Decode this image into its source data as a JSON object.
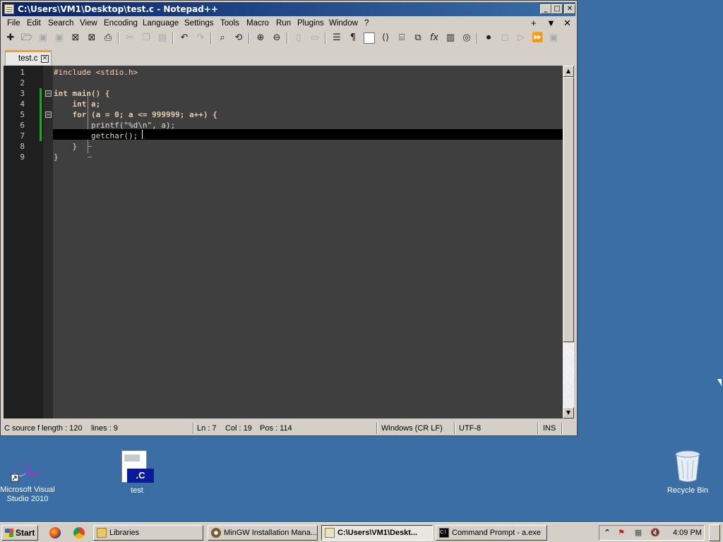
{
  "window": {
    "title": "C:\\Users\\VM1\\Desktop\\test.c - Notepad++",
    "minimize": "_",
    "maximize": "□",
    "close": "✕",
    "tab_close": "✕"
  },
  "menu": {
    "items": [
      "File",
      "Edit",
      "Search",
      "View",
      "Encoding",
      "Language",
      "Settings",
      "Tools",
      "Macro",
      "Run",
      "Plugins",
      "Window",
      "?"
    ],
    "add": "+",
    "dropdown": "▼",
    "close": "✕"
  },
  "tabs": [
    {
      "label": "test.c",
      "close": "✕"
    }
  ],
  "editor": {
    "line_numbers": [
      "1",
      "2",
      "3",
      "4",
      "5",
      "6",
      "7",
      "8",
      "9"
    ],
    "lines": [
      "#include <stdio.h>",
      "",
      "int main() {",
      "    int a;",
      "    for (a = 0; a <= 999999; a++) {",
      "        printf(\"%d\\n\", a);",
      "        getchar();",
      "    }",
      "}"
    ],
    "current_line": 7
  },
  "statusbar": {
    "filetype": "C source f",
    "length": "length : 120",
    "lines": "lines : 9",
    "ln": "Ln : 7",
    "col": "Col : 19",
    "pos": "Pos : 114",
    "eol": "Windows (CR LF)",
    "encoding": "UTF-8",
    "mode": "INS"
  },
  "desktop": {
    "icons": [
      {
        "label": "Microsoft Visual Studio 2010",
        "icon": "visual-studio-icon"
      },
      {
        "label": "test",
        "icon": "c-file-icon",
        "badge": ".C"
      },
      {
        "label": "Recycle Bin",
        "icon": "recycle-bin-icon"
      }
    ]
  },
  "taskbar": {
    "start": "Start",
    "tasks": [
      {
        "label": "Libraries",
        "icon": "folder-icon"
      },
      {
        "label": "MinGW Installation Mana...",
        "icon": "installer-icon"
      },
      {
        "label": "C:\\Users\\VM1\\Deskt...",
        "icon": "notepad-icon",
        "active": true
      },
      {
        "label": "Command Prompt - a.exe",
        "icon": "cmd-icon"
      }
    ],
    "tray": {
      "show_hidden": "⌃",
      "clock": "4:09 PM"
    }
  },
  "colors": {
    "desktop": "#3a6ea5",
    "editor_bg": "#3f3f3f",
    "gutter_bg": "#1f1f1f",
    "keyword": "#e3ceab",
    "number": "#8acccf",
    "string": "#cc9393",
    "change_bar": "#2aa02a",
    "tab_accent": "#f0a030"
  }
}
